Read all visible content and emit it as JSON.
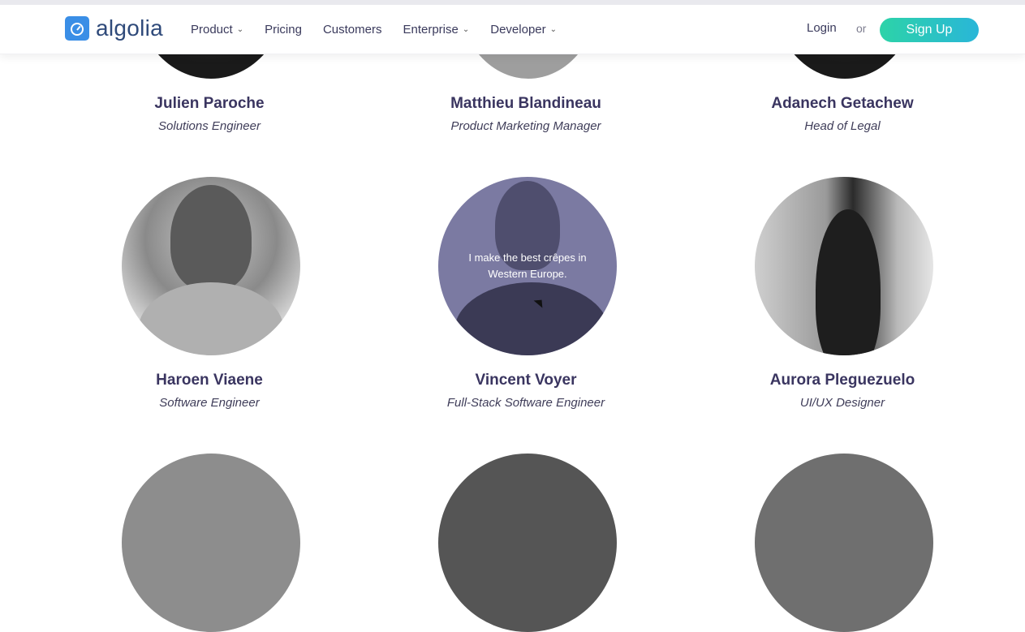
{
  "navbar": {
    "logo_text": "algolia",
    "items": [
      {
        "label": "Product",
        "has_dropdown": true
      },
      {
        "label": "Pricing",
        "has_dropdown": false
      },
      {
        "label": "Customers",
        "has_dropdown": false
      },
      {
        "label": "Enterprise",
        "has_dropdown": true
      },
      {
        "label": "Developer",
        "has_dropdown": true
      }
    ],
    "login_label": "Login",
    "or_label": "or",
    "signup_label": "Sign Up",
    "dropdown_glyph": "⌄"
  },
  "team": [
    {
      "name": "Julien Paroche",
      "role": "Solutions Engineer"
    },
    {
      "name": "Matthieu Blandineau",
      "role": "Product Marketing Manager"
    },
    {
      "name": "Adanech Getachew",
      "role": "Head of Legal"
    },
    {
      "name": "Haroen Viaene",
      "role": "Software Engineer"
    },
    {
      "name": "Vincent Voyer",
      "role": "Full-Stack Software Engineer",
      "hover_text": "I make the best crêpes in Western Europe."
    },
    {
      "name": "Aurora Pleguezuelo",
      "role": "UI/UX Designer"
    }
  ],
  "colors": {
    "brand_blue": "#3a8ee6",
    "signup_gradient_start": "#2dd3a8",
    "signup_gradient_end": "#29b6d8",
    "name_color": "#3a3560",
    "hover_overlay": "#7b7aa2"
  }
}
